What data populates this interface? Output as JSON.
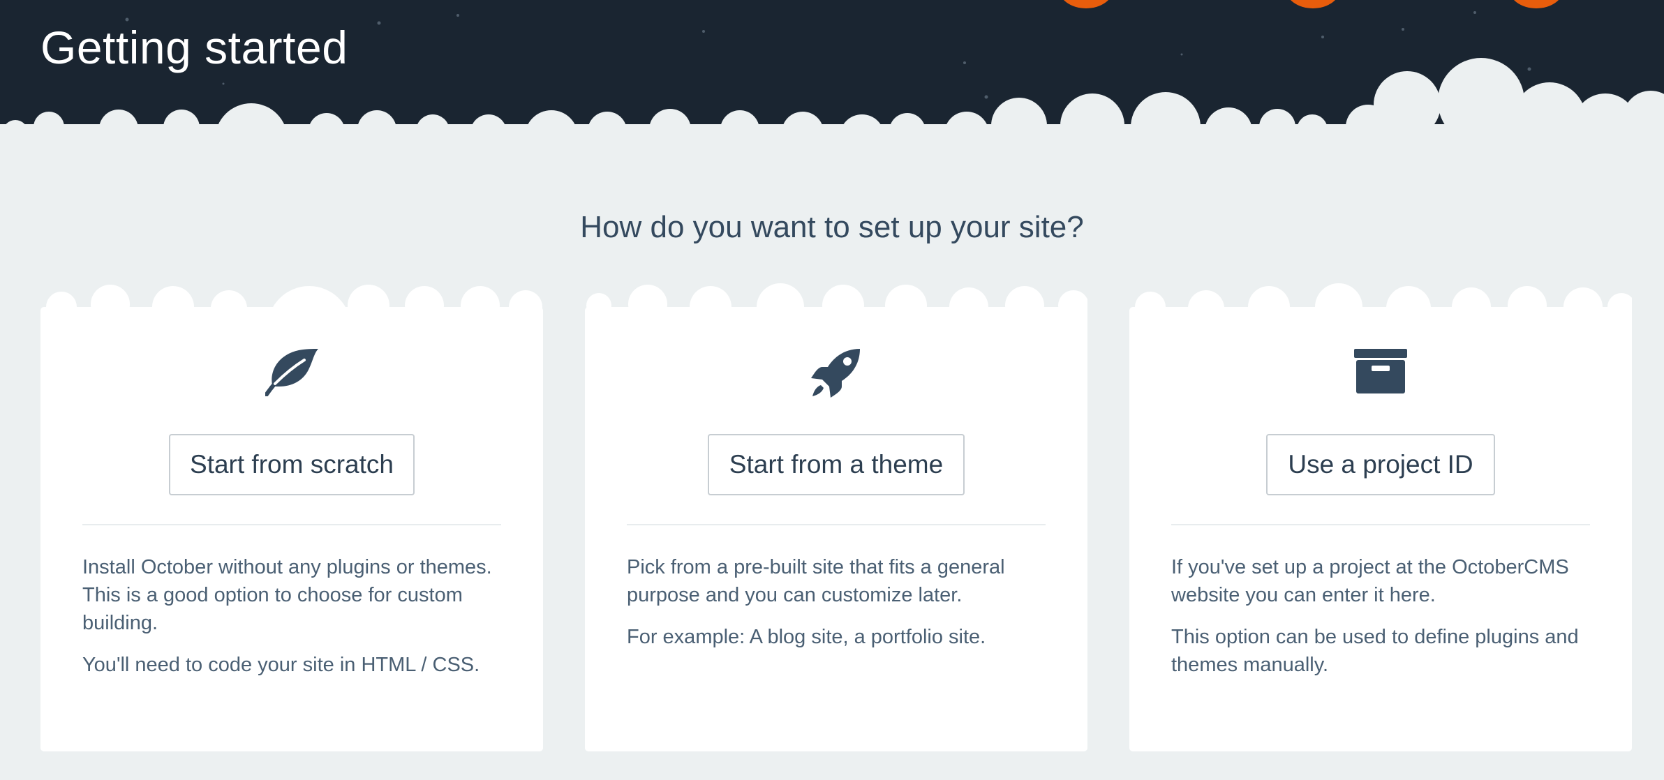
{
  "header": {
    "title": "Getting started",
    "colors": {
      "night_sky": "#1a2531",
      "cloud": "#ecf0f1",
      "accent": "#e85d0c"
    }
  },
  "question": "How do you want to set up your site?",
  "cards": [
    {
      "icon": "leaf-icon",
      "button_label": "Start from scratch",
      "paragraphs": [
        "Install October without any plugins or themes. This is a good option to choose for custom building.",
        "You'll need to code your site in HTML / CSS."
      ]
    },
    {
      "icon": "rocket-icon",
      "button_label": "Start from a theme",
      "paragraphs": [
        "Pick from a pre-built site that fits a general purpose and you can customize later.",
        "For example: A blog site, a portfolio site."
      ]
    },
    {
      "icon": "archive-box-icon",
      "button_label": "Use a project ID",
      "paragraphs": [
        "If you've set up a project at the OctoberCMS website you can enter it here.",
        "This option can be used to define plugins and themes manually."
      ]
    }
  ],
  "colors": {
    "page_background": "#ecf0f1",
    "card_background": "#ffffff",
    "heading_text": "#34495e",
    "icon": "#34495e"
  }
}
